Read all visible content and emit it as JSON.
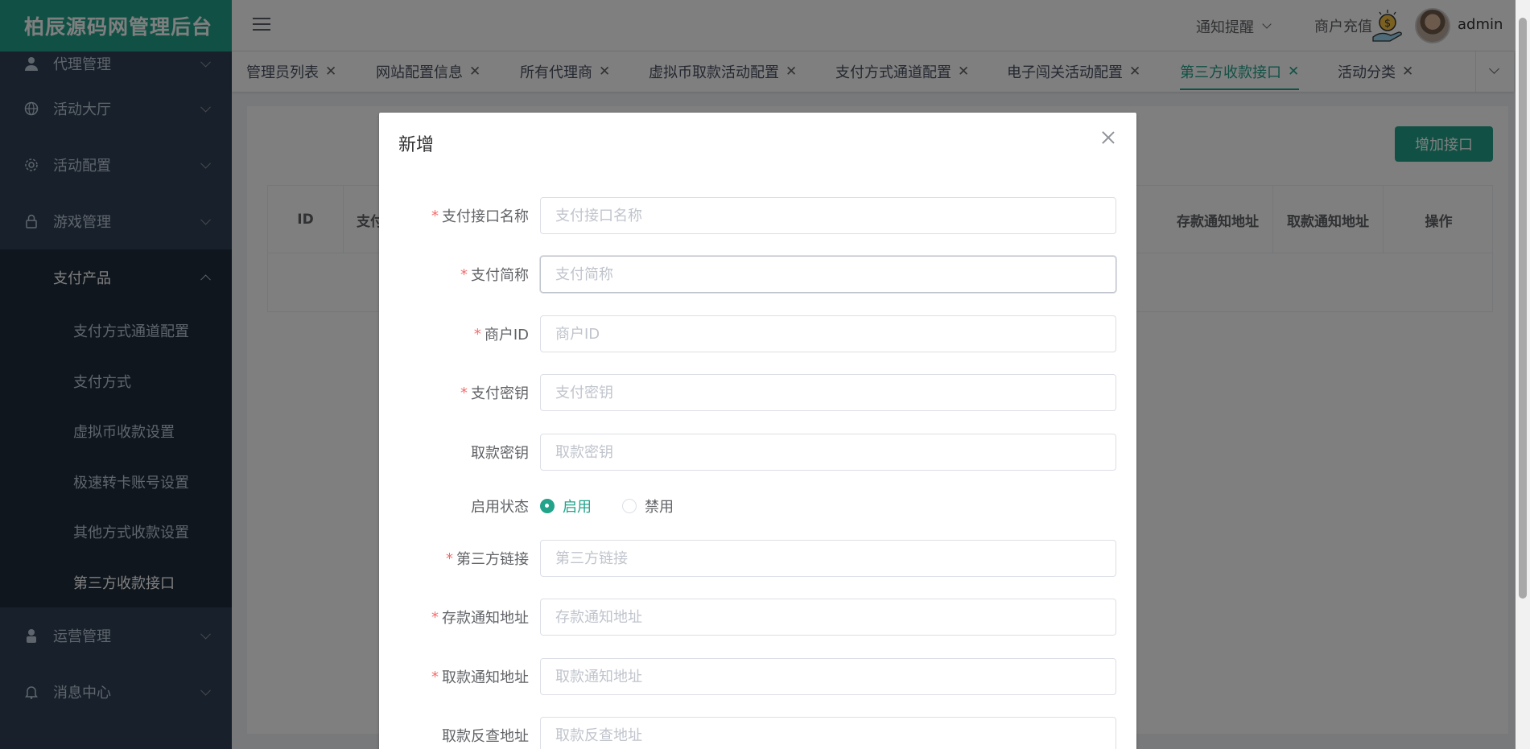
{
  "app": {
    "title": "柏辰源码网管理后台"
  },
  "sidebar": {
    "items": [
      {
        "label": "代理管理",
        "icon": "user-icon"
      },
      {
        "label": "活动大厅",
        "icon": "globe-icon"
      },
      {
        "label": "活动配置",
        "icon": "gear-icon"
      },
      {
        "label": "游戏管理",
        "icon": "lock-icon"
      }
    ],
    "open_group": {
      "label": "支付产品",
      "children": [
        {
          "label": "支付方式通道配置"
        },
        {
          "label": "支付方式"
        },
        {
          "label": "虚拟币收款设置"
        },
        {
          "label": "极速转卡账号设置"
        },
        {
          "label": "其他方式收款设置"
        },
        {
          "label": "第三方收款接口",
          "active": true
        }
      ]
    },
    "items_after": [
      {
        "label": "运营管理",
        "icon": "person-icon"
      },
      {
        "label": "消息中心",
        "icon": "bell-icon"
      }
    ]
  },
  "header": {
    "notice_label": "通知提醒",
    "recharge_label": "商户充值",
    "username": "admin"
  },
  "tags": [
    {
      "label": "管理员列表"
    },
    {
      "label": "网站配置信息"
    },
    {
      "label": "所有代理商"
    },
    {
      "label": "虚拟币取款活动配置"
    },
    {
      "label": "支付方式通道配置"
    },
    {
      "label": "电子闯关活动配置"
    },
    {
      "label": "第三方收款接口",
      "active": true
    },
    {
      "label": "活动分类"
    }
  ],
  "page": {
    "add_button": "增加接口",
    "table_headers": {
      "id": "ID",
      "pay": "支付",
      "deposit_notify": "存款通知地址",
      "withdraw_notify": "取款通知地址",
      "actions": "操作"
    }
  },
  "dialog": {
    "title": "新增",
    "fields": {
      "pay_name": {
        "label": "支付接口名称",
        "placeholder": "支付接口名称",
        "required": true
      },
      "pay_short": {
        "label": "支付简称",
        "placeholder": "支付简称",
        "required": true
      },
      "merchant_id": {
        "label": "商户ID",
        "placeholder": "商户ID",
        "required": true
      },
      "pay_key": {
        "label": "支付密钥",
        "placeholder": "支付密钥",
        "required": true
      },
      "withdraw_key": {
        "label": "取款密钥",
        "placeholder": "取款密钥",
        "required": false
      },
      "status": {
        "label": "启用状态",
        "options": [
          "启用",
          "禁用"
        ],
        "selected": "启用"
      },
      "third_link": {
        "label": "第三方链接",
        "placeholder": "第三方链接",
        "required": true
      },
      "deposit_notify": {
        "label": "存款通知地址",
        "placeholder": "存款通知地址",
        "required": true
      },
      "withdraw_notify": {
        "label": "取款通知地址",
        "placeholder": "取款通知地址",
        "required": true
      },
      "withdraw_query": {
        "label": "取款反查地址",
        "placeholder": "取款反查地址",
        "required": false
      }
    }
  },
  "colors": {
    "brand": "#22a38a",
    "sidebar_bg": "#304156",
    "required": "#f56c6c"
  }
}
